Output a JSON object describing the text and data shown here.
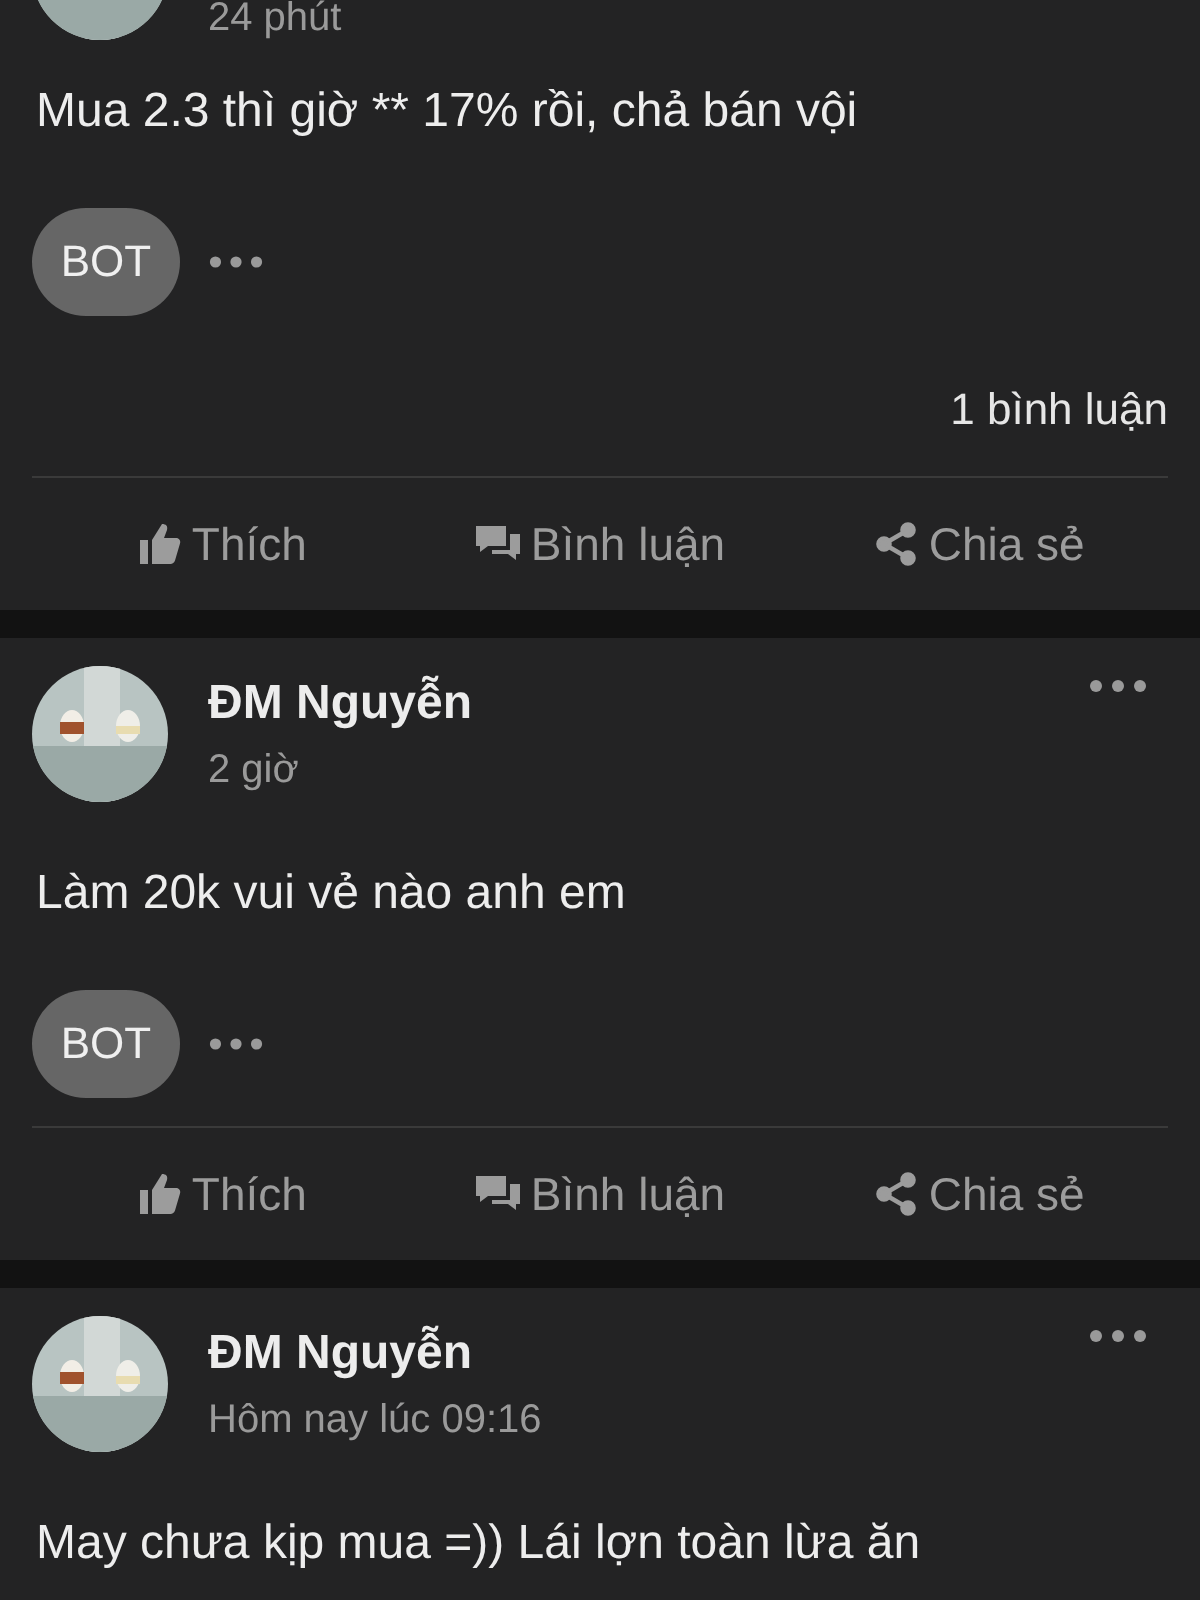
{
  "posts": [
    {
      "time": "24 phút",
      "body": "Mua 2.3 thì giờ ** 17% rồi, chả bán vội",
      "reaction_badge": "BOT",
      "comment_count": "1 bình luận",
      "actions": [
        {
          "kind": "like",
          "label": "Thích"
        },
        {
          "kind": "comment",
          "label": "Bình luận"
        },
        {
          "kind": "share",
          "label": "Chia sẻ"
        }
      ]
    },
    {
      "author": "ĐM Nguyễn",
      "time": "2 giờ",
      "body": "Làm 20k vui vẻ nào anh em",
      "reaction_badge": "BOT",
      "actions": [
        {
          "kind": "like",
          "label": "Thích"
        },
        {
          "kind": "comment",
          "label": "Bình luận"
        },
        {
          "kind": "share",
          "label": "Chia sẻ"
        }
      ]
    },
    {
      "author": "ĐM Nguyễn",
      "time": "Hôm nay lúc 09:16",
      "body": "May chưa kịp mua =)) Lái lợn toàn lừa ăn"
    }
  ]
}
